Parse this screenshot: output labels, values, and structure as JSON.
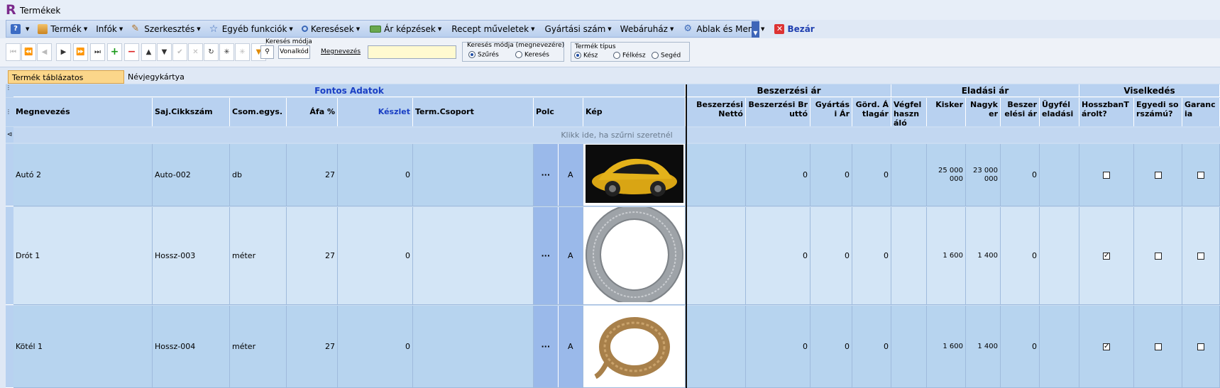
{
  "window": {
    "title": "Termékek",
    "logo": "R"
  },
  "menu": [
    {
      "label": "",
      "icon": "help-icon",
      "arrow": true
    },
    {
      "label": "Termék",
      "icon": "product-icon",
      "arrow": true
    },
    {
      "label": "Infók",
      "icon": "",
      "arrow": true
    },
    {
      "label": "Szerkesztés",
      "icon": "pencil-icon",
      "arrow": true
    },
    {
      "label": "Egyéb funkciók",
      "icon": "star-icon",
      "arrow": true
    },
    {
      "label": "Keresések",
      "icon": "search-icon",
      "arrow": true
    },
    {
      "label": "Ár képzések",
      "icon": "price-icon",
      "arrow": true
    },
    {
      "label": "Recept műveletek",
      "icon": "",
      "arrow": true
    },
    {
      "label": "Gyártási szám",
      "icon": "",
      "arrow": true
    },
    {
      "label": "Webáruház",
      "icon": "",
      "arrow": true
    },
    {
      "label": "Ablak és Menü",
      "icon": "window-icon",
      "arrow": true
    },
    {
      "label": "Bezár",
      "icon": "close-icon",
      "arrow": false
    }
  ],
  "toolbar": {
    "search_mode_label": "Keresés módja",
    "barcode_btn": "Vonalkód",
    "name_btn": "Megnevezés",
    "search_value": "",
    "mode_group_title": "Keresés módja (megnevezére)",
    "mode_options": [
      {
        "label": "Szűrés",
        "checked": true
      },
      {
        "label": "Keresés",
        "checked": false
      }
    ],
    "type_group_title": "Termék típus",
    "type_options": [
      {
        "label": "Kész",
        "checked": true
      },
      {
        "label": "Félkész",
        "checked": false
      },
      {
        "label": "Segéd",
        "checked": false
      }
    ]
  },
  "tabs": [
    "Termék táblázatos megjelenítés",
    "Névjegykártya nézet"
  ],
  "grid": {
    "bands": {
      "important": "Fontos Adatok",
      "purchase": "Beszerzési ár",
      "sale": "Eladási ár",
      "behavior": "Viselkedés"
    },
    "columns": {
      "name": "Megnevezés",
      "sku": "Saj.Cikkszám",
      "unit": "Csom.egys.",
      "vat": "Áfa %",
      "stock": "Készlet",
      "group": "Term.Csoport",
      "shelf": "Polc",
      "image": "Kép",
      "purch_net": "Beszerzési Nettó",
      "purch_gross": "Beszerzési Bruttó",
      "prod_price": "Gyártási Ár",
      "avg_price": "Görd. Átlagár",
      "end_user": "Végfelhasználó",
      "retail": "Kisker",
      "wholesale": "Nagyker",
      "purch_price": "Beszerelési ár",
      "customer": "Ügyfél eladási",
      "length_track": "HosszbanTárolt?",
      "unique_serial": "Egyedi sorszámú?",
      "warranty": "Garancia"
    },
    "filter_hint": "Klikk ide, ha szűrni szeretnél",
    "rows": [
      {
        "name": "Autó 2",
        "sku": "Auto-002",
        "unit": "db",
        "vat": "27",
        "stock": "0",
        "group": "",
        "shelf_btn": "···",
        "shelf": "A",
        "image": "car-image",
        "purch_net": "",
        "purch_gross": "0",
        "prod_price": "0",
        "avg_price": "0",
        "end_user": "",
        "retail": "25 000 000",
        "wholesale": "23 000 000",
        "purch_price": "0",
        "customer": "",
        "length_track": false,
        "unique_serial": false,
        "warranty": false
      },
      {
        "name": "Drót 1",
        "sku": "Hossz-003",
        "unit": "méter",
        "vat": "27",
        "stock": "0",
        "group": "",
        "shelf_btn": "···",
        "shelf": "A",
        "image": "wire-coil-image",
        "purch_net": "",
        "purch_gross": "0",
        "prod_price": "0",
        "avg_price": "0",
        "end_user": "",
        "retail": "1 600",
        "wholesale": "1 400",
        "purch_price": "0",
        "customer": "",
        "length_track": true,
        "unique_serial": false,
        "warranty": false
      },
      {
        "name": "Kötél 1",
        "sku": "Hossz-004",
        "unit": "méter",
        "vat": "27",
        "stock": "0",
        "group": "",
        "shelf_btn": "···",
        "shelf": "A",
        "image": "rope-image",
        "purch_net": "",
        "purch_gross": "0",
        "prod_price": "0",
        "avg_price": "0",
        "end_user": "",
        "retail": "1 600",
        "wholesale": "1 400",
        "purch_price": "0",
        "customer": "",
        "length_track": true,
        "unique_serial": false,
        "warranty": false
      }
    ]
  }
}
